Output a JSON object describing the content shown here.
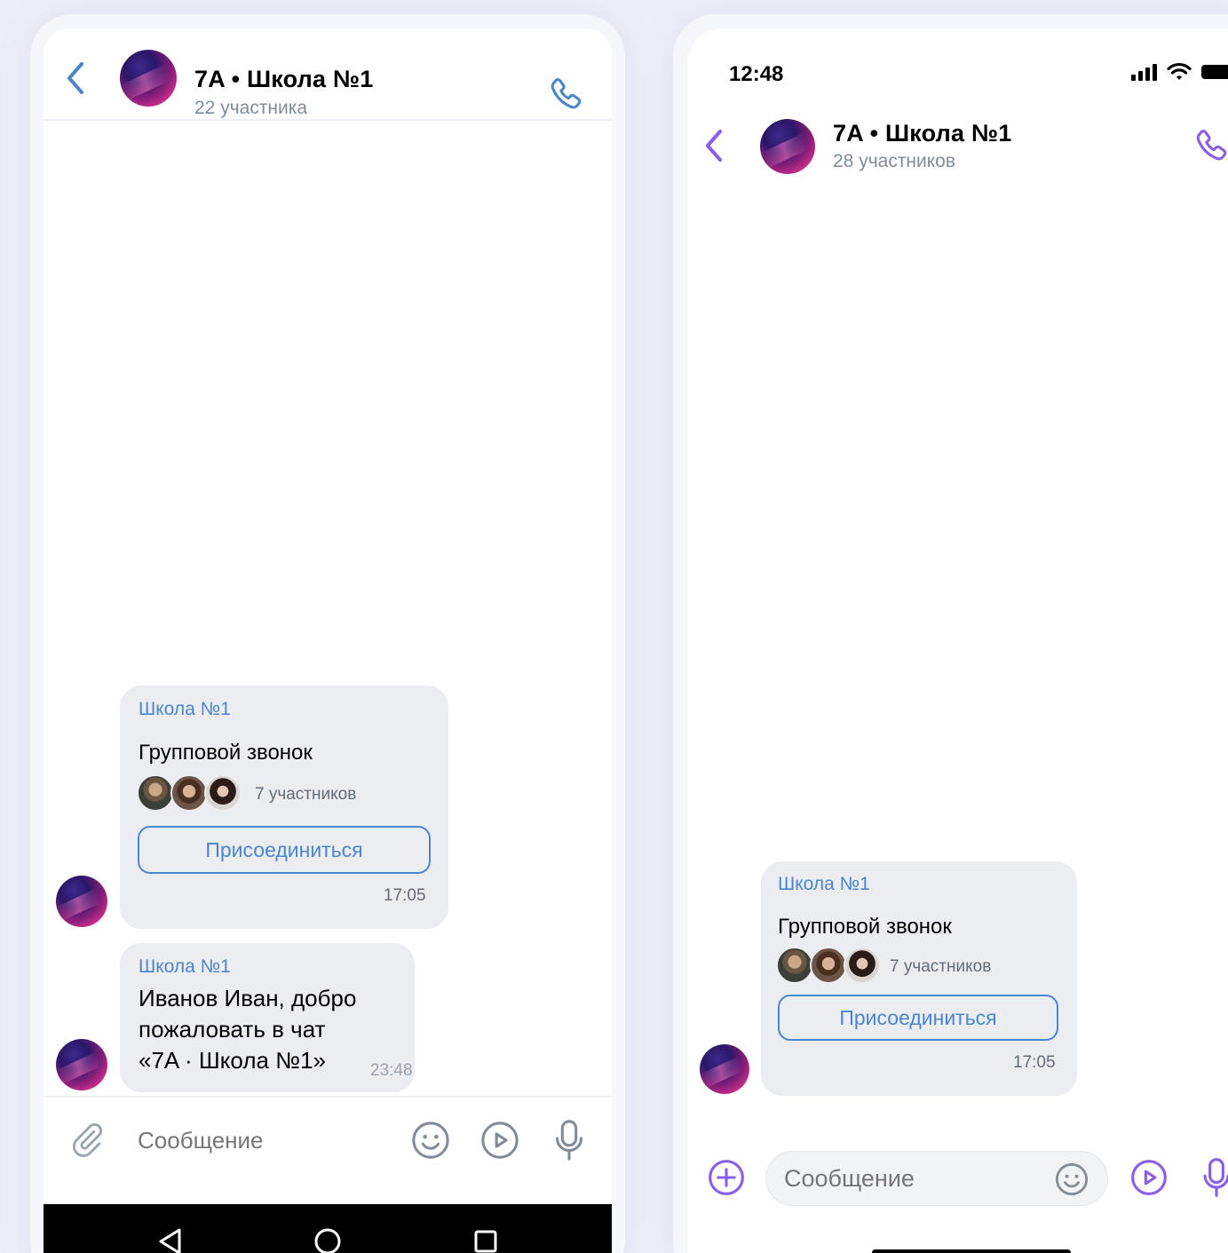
{
  "android": {
    "chat": {
      "title": "7A • Школа №1",
      "members": "22 участника"
    },
    "messages": [
      {
        "type": "group_call",
        "sender": "Школа №1",
        "title": "Групповой звонок",
        "participants": "7 участников",
        "join_label": "Присоединиться",
        "time": "17:05"
      },
      {
        "type": "text",
        "sender": "Школа №1",
        "lines": [
          "Иванов Иван, добро",
          "пожаловать в чат",
          "«7A · Школа №1»"
        ],
        "time": "23:48"
      }
    ],
    "composer": {
      "placeholder": "Сообщение"
    }
  },
  "ios": {
    "status_bar": {
      "time": "12:48"
    },
    "chat": {
      "title": "7A • Школа №1",
      "members": "28 участников"
    },
    "messages": [
      {
        "type": "group_call",
        "sender": "Школа №1",
        "title": "Групповой звонок",
        "participants": "7 участников",
        "join_label": "Присоединиться",
        "time": "17:05"
      }
    ],
    "composer": {
      "placeholder": "Сообщение"
    }
  },
  "colors": {
    "android_accent": "#4986cc",
    "ios_accent": "#8a5ee8",
    "bubble": "#ebedf0",
    "secondary_text": "#818c99"
  },
  "icons": {
    "back": "chevron-left-icon",
    "call": "phone-icon",
    "attach": "paperclip-icon",
    "emoji": "smile-icon",
    "video_message": "play-circle-icon",
    "voice": "microphone-icon",
    "add": "plus-circle-icon"
  }
}
